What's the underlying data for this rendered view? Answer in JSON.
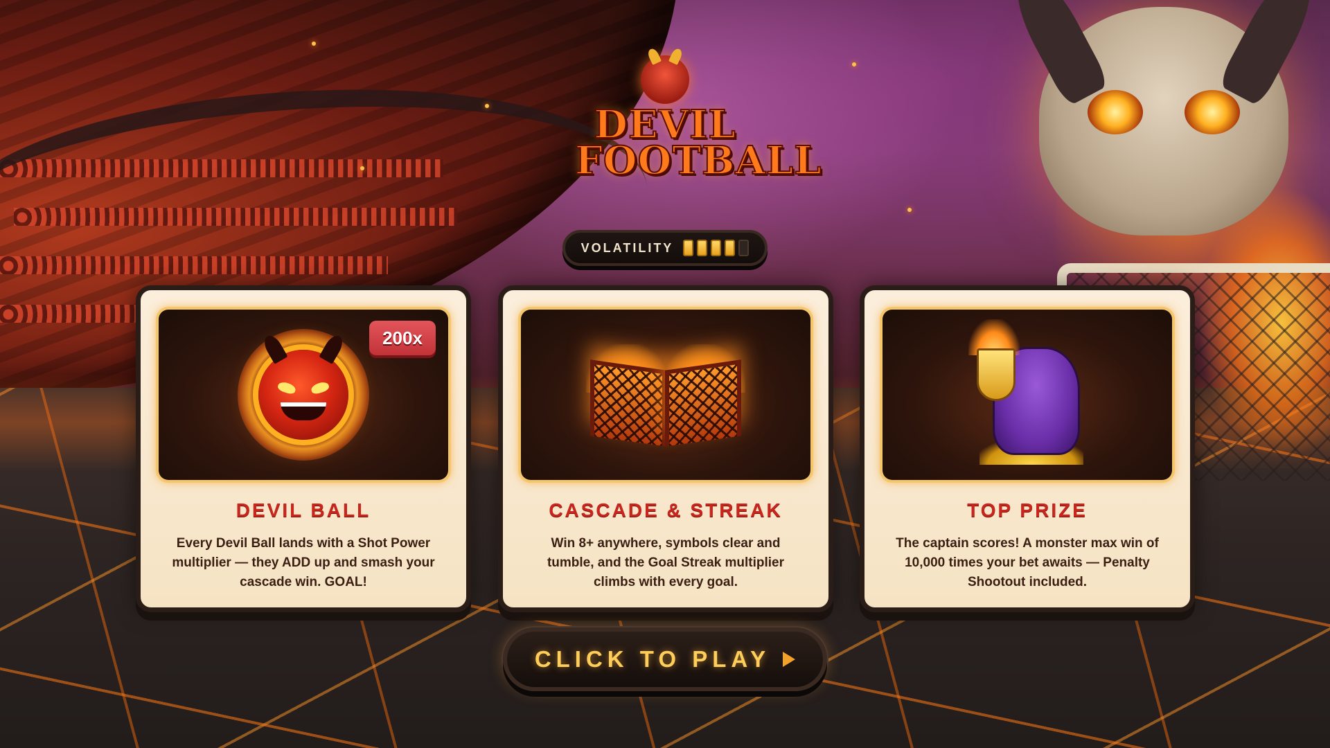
{
  "game": {
    "logo_line1": "DEVIL",
    "logo_line2": "FOOTBALL"
  },
  "volatility": {
    "label": "VOLATILITY",
    "level": 4,
    "max": 5
  },
  "cards": [
    {
      "title": "DEVIL BALL",
      "description": "Every Devil Ball lands with a Shot Power multiplier — they ADD up and smash your cascade win. GOAL!",
      "badge": "200x",
      "art_icon": "devil-ball-icon"
    },
    {
      "title": "CASCADE & STREAK",
      "description": "Win 8+ anywhere, symbols clear and tumble, and the Goal Streak multiplier climbs with every goal.",
      "art_icon": "flaming-goals-icon"
    },
    {
      "title": "TOP PRIZE",
      "description": "The captain scores! A monster max win of 10,000 times your bet awaits — Penalty Shootout included.",
      "art_icon": "captain-trophy-icon"
    }
  ],
  "play_button": {
    "label": "CLICK TO PLAY",
    "icon": "play-triangle-icon"
  },
  "colors": {
    "card_title": "#c8261c",
    "card_text": "#3a1e12",
    "card_bg": "#f8e8cf",
    "play_text": "#ffce5a",
    "badge": "#d6434a",
    "volatility_on": "#f0b42a"
  }
}
